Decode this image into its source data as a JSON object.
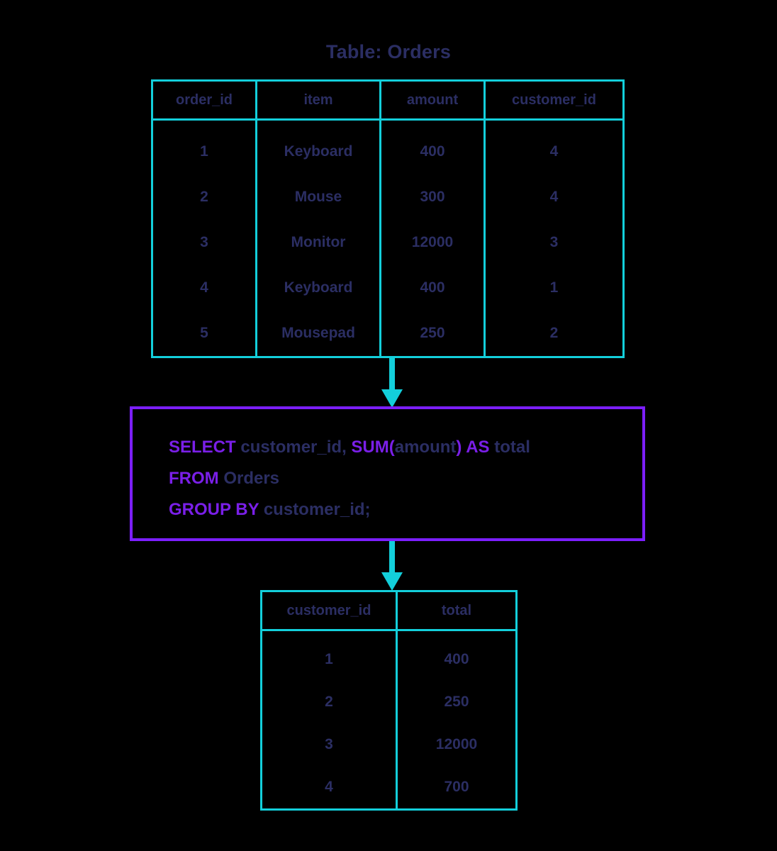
{
  "title": "Table: Orders",
  "colors": {
    "background": "#000000",
    "table_border": "#13cfdb",
    "query_box_border": "#7c1fff",
    "keyword": "#7a1fe8",
    "text": "#2b2e63",
    "arrow": "#13cfdb"
  },
  "source_table": {
    "name": "Orders",
    "columns": [
      "order_id",
      "item",
      "amount",
      "customer_id"
    ],
    "rows": [
      [
        "1",
        "Keyboard",
        "400",
        "4"
      ],
      [
        "2",
        "Mouse",
        "300",
        "4"
      ],
      [
        "3",
        "Monitor",
        "12000",
        "3"
      ],
      [
        "4",
        "Keyboard",
        "400",
        "1"
      ],
      [
        "5",
        "Mousepad",
        "250",
        "2"
      ]
    ]
  },
  "query": {
    "line1": [
      {
        "text": "SELECT",
        "keyword": true
      },
      {
        "text": " customer_id, ",
        "keyword": false
      },
      {
        "text": "SUM(",
        "keyword": true
      },
      {
        "text": "amount",
        "keyword": false
      },
      {
        "text": ")",
        "keyword": true
      },
      {
        "text": " ",
        "keyword": false
      },
      {
        "text": "AS",
        "keyword": true
      },
      {
        "text": " total",
        "keyword": false
      }
    ],
    "line2": [
      {
        "text": "FROM",
        "keyword": true
      },
      {
        "text": " Orders",
        "keyword": false
      }
    ],
    "line3": [
      {
        "text": "GROUP BY",
        "keyword": true
      },
      {
        "text": " customer_id;",
        "keyword": false
      }
    ],
    "full_text": "SELECT customer_id, SUM(amount) AS total\nFROM Orders\nGROUP BY customer_id;"
  },
  "result_table": {
    "columns": [
      "customer_id",
      "total"
    ],
    "rows": [
      [
        "1",
        "400"
      ],
      [
        "2",
        "250"
      ],
      [
        "3",
        "12000"
      ],
      [
        "4",
        "700"
      ]
    ]
  },
  "arrows": [
    {
      "name": "table-to-query",
      "direction": "down"
    },
    {
      "name": "query-to-result",
      "direction": "down"
    }
  ]
}
